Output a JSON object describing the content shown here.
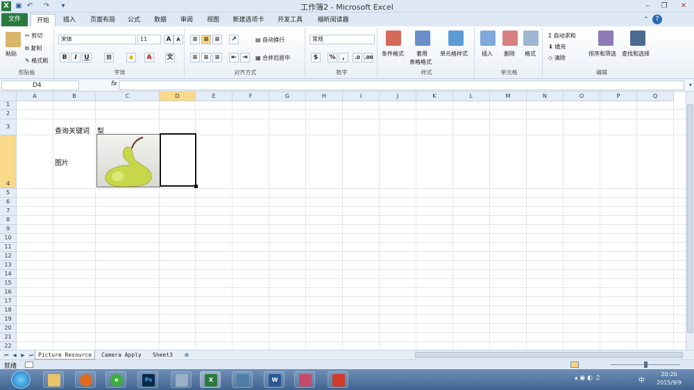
{
  "window": {
    "title": "工作簿2 - Microsoft Excel"
  },
  "tabs": [
    "文件",
    "开始",
    "插入",
    "页面布局",
    "公式",
    "数据",
    "审阅",
    "视图",
    "新建选项卡",
    "开发工具",
    "福昕阅读器"
  ],
  "ribbon": {
    "clipboard": {
      "paste": "粘贴",
      "cut": "剪切",
      "copy": "复制",
      "format_painter": "格式刷",
      "label": "剪贴板"
    },
    "font": {
      "name": "宋体",
      "size": "11",
      "bold": "B",
      "italic": "I",
      "underline": "U",
      "label": "字体"
    },
    "alignment": {
      "wrap": "自动换行",
      "merge": "合并后居中",
      "label": "对齐方式"
    },
    "number": {
      "format": "常规",
      "percent": "%",
      "comma": ",",
      "label": "数字"
    },
    "styles": {
      "conditional": "条件格式",
      "table_1": "套用",
      "table_2": "表格格式",
      "cell_styles": "单元格样式",
      "label": "样式"
    },
    "cells": {
      "insert": "插入",
      "delete": "删除",
      "format": "格式",
      "label": "单元格"
    },
    "editing": {
      "autosum": "自动求和",
      "fill": "填充",
      "clear": "清除",
      "sort": "排序和筛选",
      "find": "查找和选择",
      "label": "编辑"
    }
  },
  "formula_bar": {
    "name_box": "D4",
    "fx": "fx",
    "value": ""
  },
  "columns": [
    "A",
    "B",
    "C",
    "D",
    "E",
    "F",
    "G",
    "H",
    "I",
    "J",
    "K",
    "L",
    "M",
    "N",
    "O",
    "P",
    "Q"
  ],
  "rows": [
    "1",
    "2",
    "3",
    "4",
    "5",
    "6",
    "7",
    "8",
    "9",
    "10",
    "11",
    "12",
    "13",
    "14",
    "15",
    "16",
    "17",
    "18",
    "19",
    "20",
    "21",
    "22"
  ],
  "cells": {
    "B3": "查询关键词",
    "C3": "梨",
    "B4": "图片"
  },
  "sheets": [
    "Picture Resource",
    "Camera Apply",
    "Sheet3"
  ],
  "status": {
    "ready": "就绪"
  },
  "taskbar": {
    "clock_time": "20:20",
    "clock_date": "2015/9/9",
    "ime": "中"
  },
  "colors": {
    "file_tab": "#2a7a3e",
    "selected_header": "#f9d98a",
    "pear": "#c8d64a"
  }
}
